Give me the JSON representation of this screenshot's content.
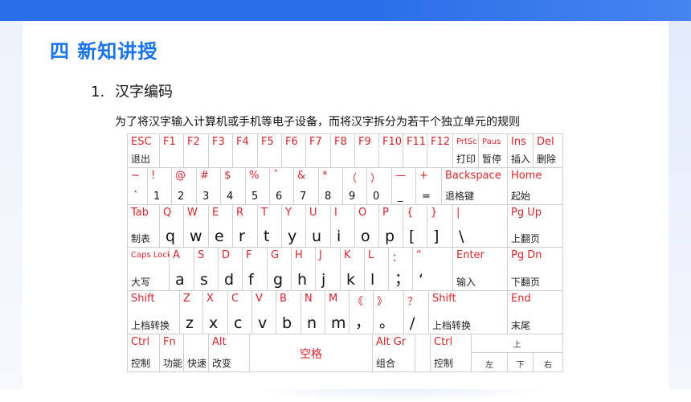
{
  "header": {
    "section_title": "四  新知讲授"
  },
  "content": {
    "subtitle_number": "1.",
    "subtitle_text": "汉字编码",
    "description": "为了将汉字输入计算机或手机等电子设备，而将汉字拆分为若干个独立单元的规则"
  },
  "keyboard": {
    "row1": [
      {
        "t": "ESC",
        "b": "退出"
      },
      {
        "t": "F1"
      },
      {
        "t": "F2"
      },
      {
        "t": "F3"
      },
      {
        "t": "F4"
      },
      {
        "t": "F5"
      },
      {
        "t": "F6"
      },
      {
        "t": "F7"
      },
      {
        "t": "F8"
      },
      {
        "t": "F9"
      },
      {
        "t": "F10"
      },
      {
        "t": "F11"
      },
      {
        "t": "F12"
      },
      {
        "t": "PrtSc",
        "b": "打印"
      },
      {
        "t": "Paus",
        "b": "暂停"
      },
      {
        "t": "Ins",
        "b": "插入"
      },
      {
        "t": "Del",
        "b": "删除"
      }
    ],
    "row2": [
      {
        "t": "~",
        "b": "`"
      },
      {
        "t": "!",
        "b": "1"
      },
      {
        "t": "@",
        "b": "2"
      },
      {
        "t": "#",
        "b": "3"
      },
      {
        "t": "$",
        "b": "4"
      },
      {
        "t": "%",
        "b": "5"
      },
      {
        "t": "ˆ",
        "b": "6"
      },
      {
        "t": "&",
        "b": "7"
      },
      {
        "t": "*",
        "b": "8"
      },
      {
        "t": "（",
        "b": "9"
      },
      {
        "t": "）",
        "b": "0"
      },
      {
        "t": "—",
        "b": "_"
      },
      {
        "t": "+",
        "b": "="
      },
      {
        "t": "Backspace",
        "b": "退格键"
      },
      {
        "t": "Home",
        "b": "起始"
      }
    ],
    "row3": [
      {
        "t": "Tab",
        "b": "制表"
      },
      {
        "t": "Q",
        "b": "q"
      },
      {
        "t": "W",
        "b": "w"
      },
      {
        "t": "E",
        "b": "e"
      },
      {
        "t": "R",
        "b": "r"
      },
      {
        "t": "T",
        "b": "t"
      },
      {
        "t": "Y",
        "b": "y"
      },
      {
        "t": "U",
        "b": "u"
      },
      {
        "t": "I",
        "b": "i"
      },
      {
        "t": "O",
        "b": "o"
      },
      {
        "t": "P",
        "b": "p"
      },
      {
        "t": "{",
        "b": "["
      },
      {
        "t": "}",
        "b": "]"
      },
      {
        "t": "|",
        "b": "\\"
      },
      {
        "t": "Pg Up",
        "b": "上翻页"
      }
    ],
    "row4": [
      {
        "t": "Caps Lock",
        "b": "大写"
      },
      {
        "t": "A",
        "b": "a"
      },
      {
        "t": "S",
        "b": "s"
      },
      {
        "t": "D",
        "b": "d"
      },
      {
        "t": "F",
        "b": "f"
      },
      {
        "t": "G",
        "b": "g"
      },
      {
        "t": "H",
        "b": "h"
      },
      {
        "t": "J",
        "b": "j"
      },
      {
        "t": "K",
        "b": "k"
      },
      {
        "t": "L",
        "b": "l"
      },
      {
        "t": "：",
        "b": "；"
      },
      {
        "t": "“",
        "b": "‘"
      },
      {
        "t": "Enter",
        "b": "输入"
      },
      {
        "t": "Pg Dn",
        "b": "下翻页"
      }
    ],
    "row5": [
      {
        "t": "Shift",
        "b": "上档转换"
      },
      {
        "t": "Z",
        "b": "z"
      },
      {
        "t": "X",
        "b": "x"
      },
      {
        "t": "C",
        "b": "c"
      },
      {
        "t": "V",
        "b": "v"
      },
      {
        "t": "B",
        "b": "b"
      },
      {
        "t": "N",
        "b": "n"
      },
      {
        "t": "M",
        "b": "m"
      },
      {
        "t": "《",
        "b": "，"
      },
      {
        "t": "》",
        "b": "。"
      },
      {
        "t": "？",
        "b": "/"
      },
      {
        "t": "Shift",
        "b": "上档转换"
      },
      {
        "t": "End",
        "b": "末尾"
      }
    ],
    "row6": [
      {
        "t": "Ctrl",
        "b": "控制"
      },
      {
        "t": "Fn",
        "b": "功能"
      },
      {
        "t": "",
        "b": "快速"
      },
      {
        "t": "Alt",
        "b": "改变"
      },
      {
        "t": "空格"
      },
      {
        "t": "Alt Gr",
        "b": "组合"
      },
      {
        "t": ""
      },
      {
        "t": "Ctrl",
        "b": "控制"
      },
      {
        "t": "上"
      },
      {
        "t": "",
        "b": "左"
      },
      {
        "t": "",
        "b": "下"
      },
      {
        "t": "",
        "b": "右"
      }
    ]
  },
  "colors": {
    "accent": "#1a73e8",
    "key_red": "#d3252b",
    "band": "#2b6fe8"
  }
}
